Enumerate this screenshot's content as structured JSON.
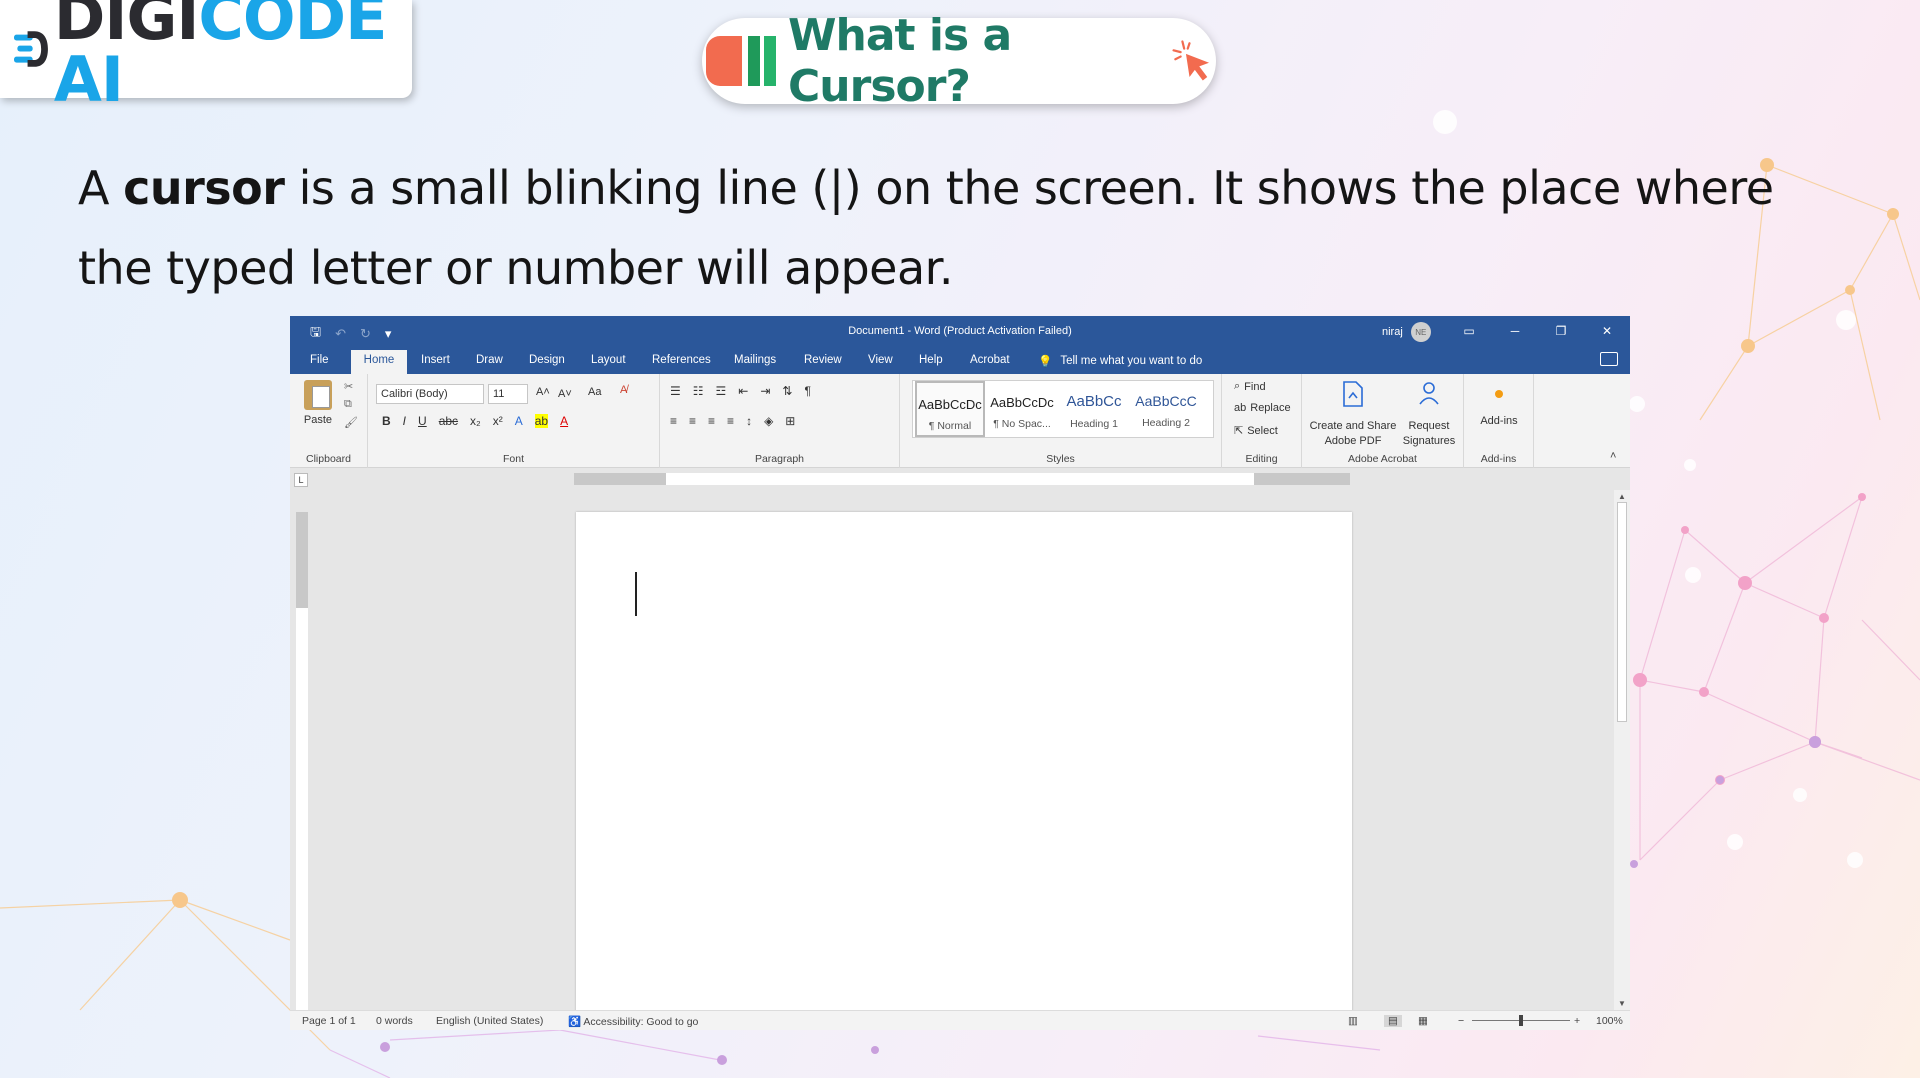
{
  "logo": {
    "part1": "DIGI",
    "part2": "CODE",
    "part3": "AI"
  },
  "header": {
    "title": "What is a Cursor?"
  },
  "description": {
    "p1": "A ",
    "bold": "cursor",
    "p2": " is a small blinking line (|) on the screen. It shows the place where the typed letter or number will appear."
  },
  "word": {
    "window_title": "Document1  -  Word (Product Activation Failed)",
    "user": "niraj",
    "avatar": "NE",
    "tabs": [
      "File",
      "Home",
      "Insert",
      "Draw",
      "Design",
      "Layout",
      "References",
      "Mailings",
      "Review",
      "View",
      "Help",
      "Acrobat"
    ],
    "tell_me": "Tell me what you want to do",
    "ribbon": {
      "paste": "Paste",
      "font_name": "Calibri (Body)",
      "font_size": "11",
      "change_case": "Aa",
      "groups": [
        "Clipboard",
        "Font",
        "Paragraph",
        "Styles",
        "Editing",
        "Adobe Acrobat",
        "Add-ins"
      ],
      "styles": [
        {
          "preview": "AaBbCcDc",
          "name": "¶ Normal"
        },
        {
          "preview": "AaBbCcDc",
          "name": "¶ No Spac..."
        },
        {
          "preview": "AaBbCc",
          "name": "Heading 1"
        },
        {
          "preview": "AaBbCcC",
          "name": "Heading 2"
        }
      ],
      "editing": [
        "Find",
        "Replace",
        "Select"
      ],
      "acrobat": [
        "Create and Share",
        "Adobe PDF",
        "Request",
        "Signatures"
      ],
      "addins": "Add-ins"
    },
    "status": {
      "page": "Page 1 of 1",
      "words": "0 words",
      "language": "English (United States)",
      "accessibility": "Accessibility: Good to go",
      "zoom": "100%"
    }
  },
  "colors": {
    "word_blue": "#2b579a",
    "brand_blue": "#1aa5e8",
    "title_green": "#1f7a66",
    "accent_orange": "#f26b4f"
  },
  "icons": [
    "save-icon",
    "undo-icon",
    "redo-icon",
    "lightbulb-icon",
    "cursor-click-icon",
    "comment-icon"
  ]
}
